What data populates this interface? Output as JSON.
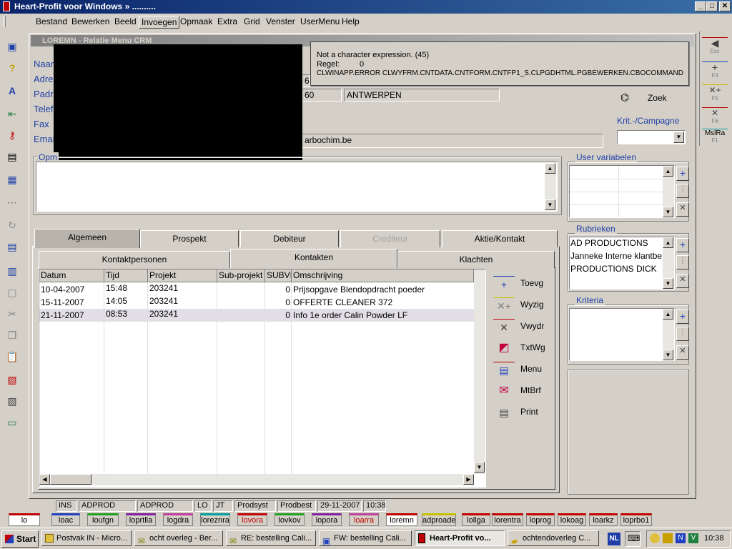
{
  "app": {
    "title": "Heart-Profit voor Windows  »  .........."
  },
  "menu": [
    "Bestand",
    "Bewerken",
    "Beeld",
    "Invoegen",
    "Opmaak",
    "Extra",
    "Grid",
    "Venster",
    "UserMenu",
    "Help"
  ],
  "window": {
    "title": "LOREMN - Relatie Menu CRM"
  },
  "error": {
    "line1": "Not a character expression. (45)",
    "line2_label": "Regel:",
    "line2_value": "0",
    "line3": "CLWINAPP.ERROR  CLWYFRM.CNTDATA.CNTFORM.CNTFP1_S.CLPGDHTML.PGBEWERKEN.CBOCOMMAND"
  },
  "form": {
    "naam": "Naam",
    "adres": "Adres",
    "padres": "Padres",
    "telefoon": "Telef",
    "fax": "Fax",
    "email": "Email",
    "postcode": "60",
    "city": "ANTWERPEN",
    "row1_partial": "6",
    "email_value": "arbochim.be",
    "zoek": "Zoek",
    "krit": "Krit.-/Campagne",
    "opmerkingen": "Opm"
  },
  "tabs_main": [
    "Algemeen",
    "Prospekt",
    "Debiteur",
    "Crediteur",
    "Aktie/Kontakt"
  ],
  "tabs_sub": [
    "Kontaktpersonen",
    "Kontakten",
    "Klachten"
  ],
  "grid": {
    "columns": [
      "Datum",
      "Tijd",
      "Projekt",
      "Sub-projekt",
      "SUBVI",
      "Omschrijving"
    ],
    "rows": [
      [
        "10-04-2007",
        "15:48",
        "203241",
        "",
        "0",
        "Prijsopgave Blendopdracht poeder"
      ],
      [
        "15-11-2007",
        "14:05",
        "203241",
        "",
        "0",
        "OFFERTE CLEANER 372"
      ],
      [
        "21-11-2007",
        "08:53",
        "203241",
        "",
        "0",
        "Info 1e order Calin Powder LF"
      ]
    ]
  },
  "actions": [
    "Toevg",
    "Wyzig",
    "Vwydr",
    "TxtWg",
    "Menu",
    "MtBrf",
    "Print"
  ],
  "panels": {
    "user_var": "User variabelen",
    "rubrieken": "Rubrieken",
    "rubrieken_items": [
      "AD PRODUCTIONS",
      "Janneke Interne klantbe",
      "PRODUCTIONS DICK"
    ],
    "kriteria": "Kriteria"
  },
  "fkeys": [
    {
      "label": "Esc",
      "color": "#c00000"
    },
    {
      "label": "F4",
      "color": "#2040c0"
    },
    {
      "label": "F5",
      "color": "#c8c000"
    },
    {
      "label": "F6",
      "color": "#c00000"
    },
    {
      "label": "MslRa",
      "sub": "F1",
      "color": "#00a0a0"
    }
  ],
  "status": [
    "INS",
    "ADPROD",
    "ADPROD",
    "LO",
    "JT",
    "Prodsyst",
    "Prodbest",
    "29-11-2007",
    "10:38"
  ],
  "modules": [
    {
      "label": "lo",
      "color": "#c00000"
    },
    {
      "label": "loac",
      "color": "#2040c0"
    },
    {
      "label": "loufgn",
      "color": "#20a020"
    },
    {
      "label": "loprtlla",
      "color": "#8020a0"
    },
    {
      "label": "logdra",
      "color": "#c040a0"
    },
    {
      "label": "loreznra",
      "color": "#00a0a0"
    },
    {
      "label": "lovora",
      "color": "#c00000"
    },
    {
      "label": "lovkov",
      "color": "#20a020"
    },
    {
      "label": "lopora",
      "color": "#8020a0"
    },
    {
      "label": "loarra",
      "color": "#c040a0"
    },
    {
      "label": "loremn",
      "color": "#c00000"
    },
    {
      "label": "adproade",
      "color": "#c8c000"
    },
    {
      "label": "lollga",
      "color": "#c00000"
    },
    {
      "label": "lorentra",
      "color": "#c00000"
    },
    {
      "label": "loprog",
      "color": "#c00000"
    },
    {
      "label": "lokoag",
      "color": "#c00000"
    },
    {
      "label": "loarkz",
      "color": "#c00000"
    },
    {
      "label": "loprbo1",
      "color": "#c00000"
    }
  ],
  "taskbar": {
    "start": "Start",
    "items": [
      "Postvak IN - Micro...",
      "ocht overleg - Ber...",
      "RE: bestelling Cali...",
      "FW: bestelling Cali...",
      "Heart-Profit vo...",
      "ochtendoverleg C..."
    ],
    "lang": "NL",
    "clock": "10:38"
  }
}
